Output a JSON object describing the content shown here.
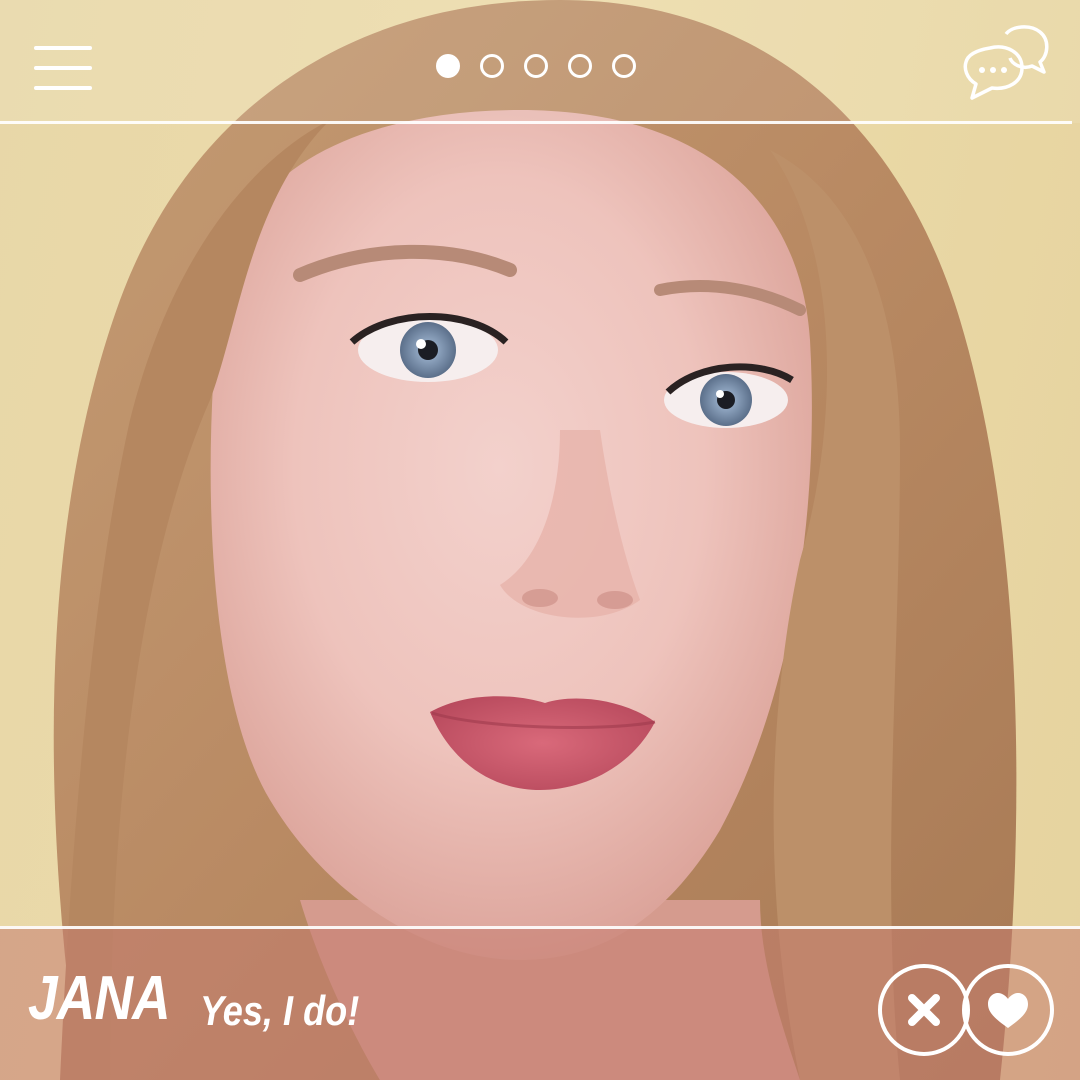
{
  "header": {
    "pager": {
      "count": 5,
      "active_index": 0
    },
    "icons": {
      "menu": "hamburger-menu-icon",
      "chat": "chat-bubbles-icon"
    }
  },
  "profile": {
    "name": "JANA",
    "status": "Yes, I do!"
  },
  "actions": {
    "dislike_icon": "close-icon",
    "like_icon": "heart-icon"
  },
  "colors": {
    "ui_white": "#ffffff",
    "background_yellow": "#e8d7a8",
    "footer_tint": "#c47c70"
  }
}
